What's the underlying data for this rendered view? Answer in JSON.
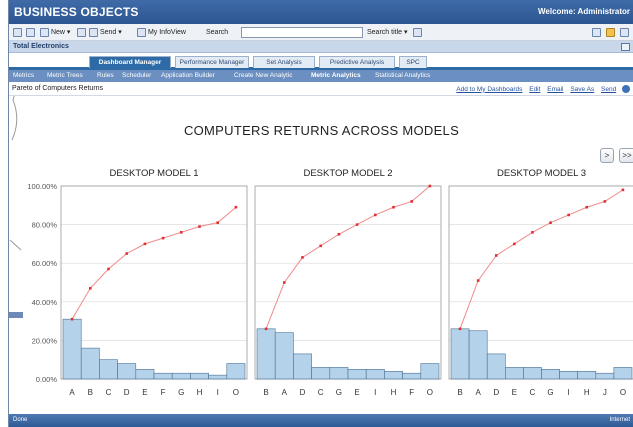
{
  "app": {
    "brand": "BUSINESS OBJECTS",
    "welcome": "Welcome: Administrator"
  },
  "toolbar": {
    "new_label": "New",
    "send_label": "Send",
    "my_infoview_label": "My InfoView",
    "search_label": "Search",
    "search_value": "",
    "search_title_label": "Search title"
  },
  "context": {
    "title": "Total Electronics"
  },
  "tabs": [
    {
      "label": "Dashboard Manager",
      "active": true
    },
    {
      "label": "Performance Manager",
      "active": false
    },
    {
      "label": "Set Analysis",
      "active": false
    },
    {
      "label": "Predictive Analysis",
      "active": false
    },
    {
      "label": "SPC",
      "active": false
    }
  ],
  "subnav": [
    {
      "label": "Metrics",
      "active": false
    },
    {
      "label": "Metric Trees",
      "active": false
    },
    {
      "label": "Rules",
      "active": false
    },
    {
      "label": "Scheduler",
      "active": false
    },
    {
      "label": "Application Builder",
      "active": false
    },
    {
      "label": "Create New Analytic",
      "active": false
    },
    {
      "label": "Metric Analytics",
      "active": true
    },
    {
      "label": "Statistical Analytics",
      "active": false
    }
  ],
  "page": {
    "title": "Pareto of Computers Returns",
    "actions": [
      "Add to My Dashboards",
      "Edit",
      "Email",
      "Save As",
      "Send"
    ]
  },
  "dashboard": {
    "title": "COMPUTERS RETURNS ACROSS MODELS",
    "next_label": ">",
    "last_label": ">>"
  },
  "status": {
    "left": "Done",
    "right": "Internet"
  },
  "colors": {
    "brand_blue": "#2c5691",
    "tab_active": "#2d6aa6",
    "bar_fill": "#b4d3ea",
    "bar_stroke": "#4a6f93",
    "cumulative_line": "#f08a8a",
    "cumulative_marker": "#e03030"
  },
  "chart_data": [
    {
      "type": "bar",
      "title": "DESKTOP MODEL 1",
      "categories": [
        "A",
        "B",
        "C",
        "D",
        "E",
        "F",
        "G",
        "H",
        "I",
        "O"
      ],
      "series": [
        {
          "type": "bar",
          "values": [
            31,
            16,
            10,
            8,
            5,
            3,
            3,
            3,
            2,
            8
          ]
        },
        {
          "type": "line",
          "values": [
            31,
            47,
            57,
            65,
            70,
            73,
            76,
            79,
            81,
            89
          ]
        }
      ],
      "ylim": [
        0,
        100
      ],
      "yticks": [
        "0.00%",
        "20.00%",
        "40.00%",
        "60.00%",
        "80.00%",
        "100.00%"
      ]
    },
    {
      "type": "bar",
      "title": "DESKTOP MODEL 2",
      "categories": [
        "B",
        "A",
        "D",
        "C",
        "G",
        "E",
        "I",
        "H",
        "F",
        "O"
      ],
      "series": [
        {
          "type": "bar",
          "values": [
            26,
            24,
            13,
            6,
            6,
            5,
            5,
            4,
            3,
            8
          ]
        },
        {
          "type": "line",
          "values": [
            26,
            50,
            63,
            69,
            75,
            80,
            85,
            89,
            92,
            100
          ]
        }
      ],
      "ylim": [
        0,
        100
      ],
      "yticks": [
        "0.00%",
        "20.00%",
        "40.00%",
        "60.00%",
        "80.00%",
        "100.00%"
      ]
    },
    {
      "type": "bar",
      "title": "DESKTOP MODEL 3",
      "categories": [
        "B",
        "A",
        "D",
        "E",
        "C",
        "G",
        "I",
        "H",
        "J",
        "O"
      ],
      "series": [
        {
          "type": "bar",
          "values": [
            26,
            25,
            13,
            6,
            6,
            5,
            4,
            4,
            3,
            6
          ]
        },
        {
          "type": "line",
          "values": [
            26,
            51,
            64,
            70,
            76,
            81,
            85,
            89,
            92,
            98
          ]
        }
      ],
      "ylim": [
        0,
        100
      ],
      "yticks": [
        "0.00%",
        "20.00%",
        "40.00%",
        "60.00%",
        "80.00%",
        "100.00%"
      ]
    }
  ]
}
